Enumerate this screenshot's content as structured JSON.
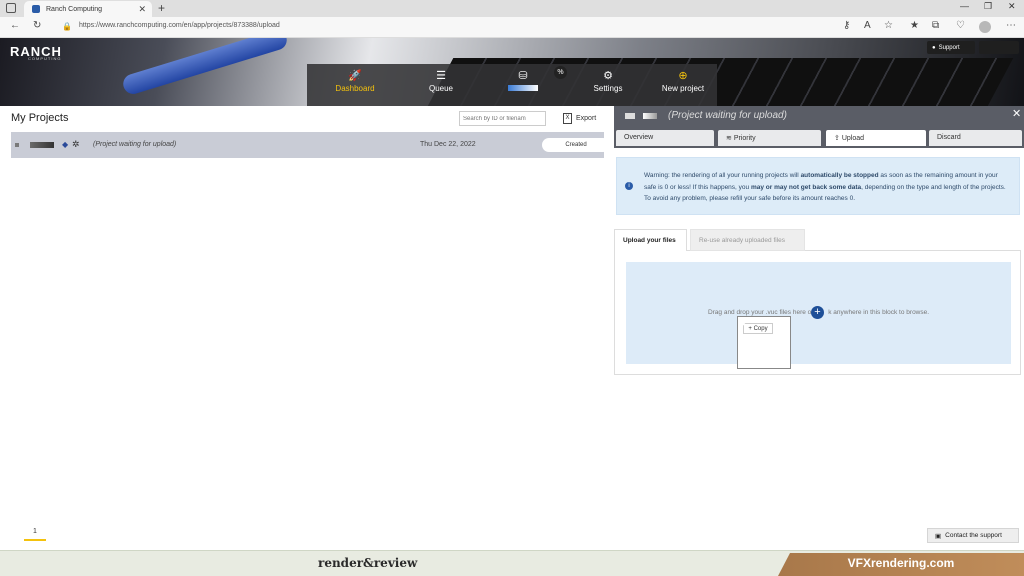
{
  "browser": {
    "tab_title": "Ranch Computing",
    "url": "https://www.ranchcomputing.com/en/app/projects/873388/upload"
  },
  "site": {
    "logo": "RANCH",
    "logo_sub": "COMPUTING",
    "support_label": "Support",
    "nav": [
      {
        "label": "Dashboard",
        "icon": "rocket-icon",
        "active": true
      },
      {
        "label": "Queue",
        "icon": "list-check-icon"
      },
      {
        "label": "",
        "icon": "coins-icon",
        "badge": "%"
      },
      {
        "label": "Settings",
        "icon": "gears-icon"
      },
      {
        "label": "New project",
        "icon": "plus-circle-icon"
      }
    ]
  },
  "left": {
    "title": "My Projects",
    "search_placeholder": "Search by ID or filenam",
    "export_label": "Export",
    "project": {
      "name": "(Project waiting for upload)",
      "date": "Thu Dec 22, 2022",
      "status": "Created"
    },
    "page": "1"
  },
  "right": {
    "title": "(Project waiting for upload)",
    "tabs": [
      "Overview",
      "Priority",
      "Upload",
      "Discard"
    ],
    "active_tab": "Upload",
    "warning": {
      "p1": "Warning: the rendering of all your running projects will ",
      "b1": "automatically be stopped",
      "p2": " as soon as the remaining amount in your safe is 0 or less! If this happens, you ",
      "b2": "may or may not get back some data",
      "p3": ", depending on the type and length of the projects. To avoid any problem, please refill your safe before its amount reaches 0."
    },
    "upload_tabs": [
      "Upload your files",
      "Re-use already uploaded files"
    ],
    "drop_text_left": "Drag and drop your .vuc files here or ",
    "drop_text_right": "k anywhere in this block to browse.",
    "copy_label": "+ Copy"
  },
  "contact_label": "Contact the support",
  "footer": {
    "left_brand": "render&review",
    "right_brand": "VFXrendering.com"
  }
}
